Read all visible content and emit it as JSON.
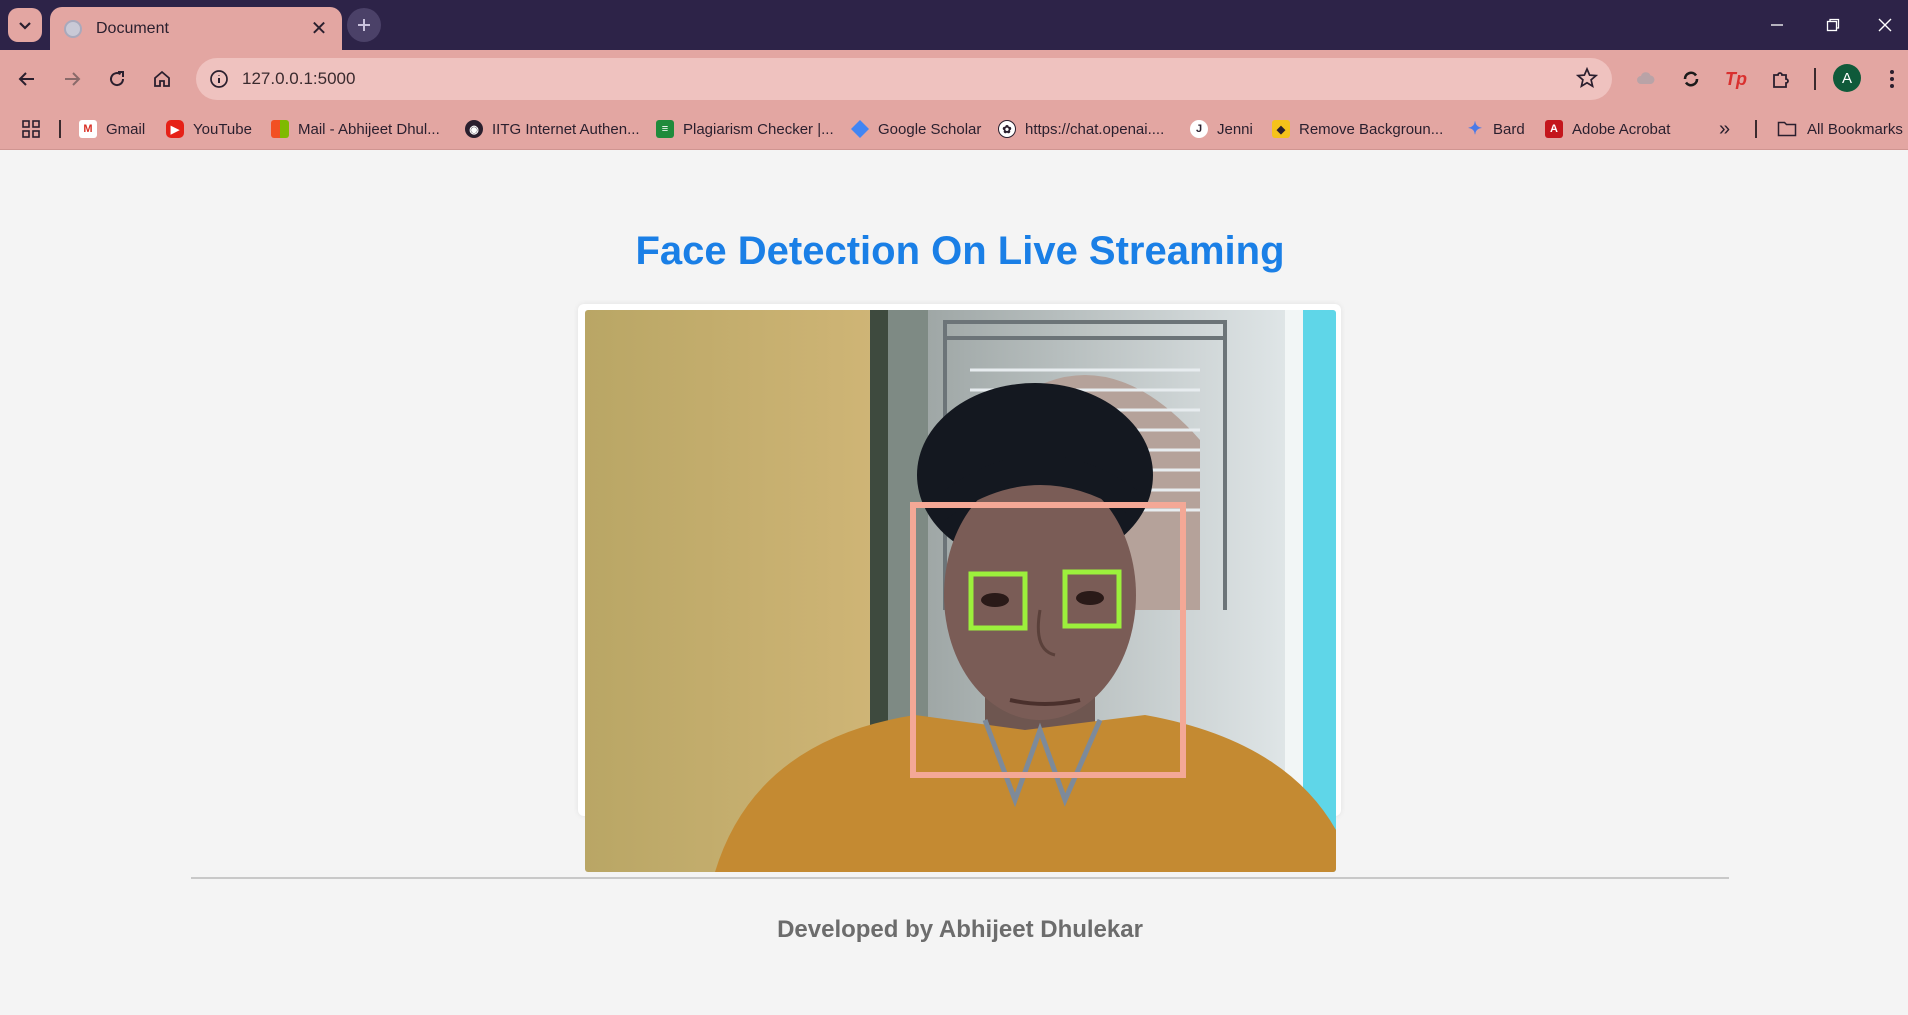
{
  "browser": {
    "tab": {
      "title": "Document",
      "close": "✕"
    },
    "new_tab": "+",
    "address": {
      "url": "127.0.0.1:5000"
    },
    "profile_initial": "A",
    "extensions": {
      "tp_label": "Tp"
    },
    "window_controls": {
      "minimize": "—",
      "restore": "❐",
      "close": "✕"
    }
  },
  "bookmarks": {
    "items": [
      {
        "label": "Gmail",
        "icon": "gmail-icon"
      },
      {
        "label": "YouTube",
        "icon": "youtube-icon"
      },
      {
        "label": "Mail - Abhijeet Dhul...",
        "icon": "microsoft-icon"
      },
      {
        "label": "IITG Internet Authen...",
        "icon": "globe-icon"
      },
      {
        "label": "Plagiarism Checker |...",
        "icon": "plagiarism-checker-icon"
      },
      {
        "label": "Google Scholar",
        "icon": "google-scholar-icon"
      },
      {
        "label": "https://chat.openai....",
        "icon": "openai-icon"
      },
      {
        "label": "Jenni",
        "icon": "jenni-icon"
      },
      {
        "label": "Remove Backgroun...",
        "icon": "remove-bg-icon"
      },
      {
        "label": "Bard",
        "icon": "bard-icon"
      },
      {
        "label": "Adobe Acrobat",
        "icon": "adobe-acrobat-icon"
      }
    ],
    "overflow": "»",
    "all_bookmarks": "All Bookmarks"
  },
  "page": {
    "title": "Face Detection On Live Streaming",
    "footer": "Developed by Abhijeet Dhulekar"
  },
  "colors": {
    "title": "#1a7fe6",
    "face_box": "#f4a896",
    "eye_box": "#9cf03c",
    "browser_frame": "#e3a6a2",
    "titlebar": "#2d2348"
  }
}
